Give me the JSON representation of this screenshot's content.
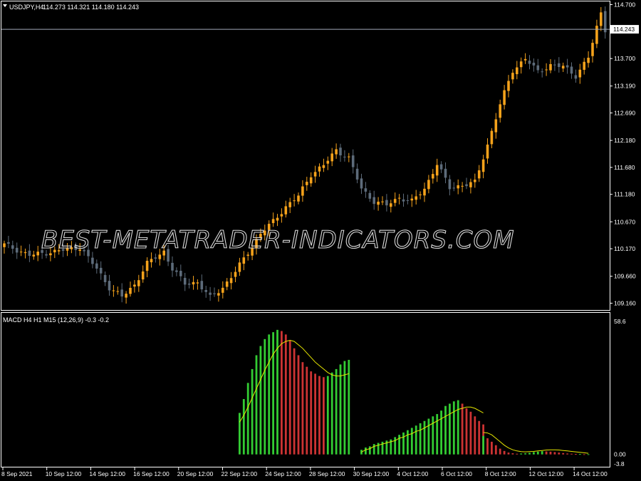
{
  "symbol_header": {
    "symbol": "USDJPY,H4",
    "ohlc": "114.273 114.321 114.180 114.243"
  },
  "current_price": "114.243",
  "watermark": "BEST-METATRADER-INDICATORS.COM",
  "indicator_header": "MACD H4 H1 M15 (12,26,9) -0.3 -0.2",
  "colors": {
    "background": "#000000",
    "frame": "#ffffff",
    "bull_candle": "#f5a21b",
    "bear_candle": "#5d6b7a",
    "hist_up": "#33cc33",
    "hist_down": "#cc3333",
    "signal": "#e6e600",
    "price_line": "#a0a8b8"
  },
  "chart_data": [
    {
      "type": "candlestick",
      "title": "USDJPY,H4",
      "price_axis": [
        "114.700",
        "114.243",
        "113.700",
        "113.190",
        "112.690",
        "112.180",
        "111.680",
        "111.180",
        "110.670",
        "110.170",
        "109.660",
        "109.160"
      ],
      "ylim": [
        109.1,
        114.72
      ],
      "time_axis": [
        "8 Sep 2021",
        "10 Sep 12:00",
        "14 Sep 12:00",
        "16 Sep 12:00",
        "20 Sep 12:00",
        "22 Sep 12:00",
        "24 Sep 12:00",
        "28 Sep 12:00",
        "30 Sep 12:00",
        "4 Oct 12:00",
        "6 Oct 12:00",
        "8 Oct 12:00",
        "12 Oct 12:00",
        "14 Oct 12:00"
      ],
      "close_anchors": [
        [
          0,
          110.25
        ],
        [
          6,
          110.05
        ],
        [
          12,
          110.12
        ],
        [
          18,
          110.2
        ],
        [
          22,
          109.8
        ],
        [
          25,
          109.45
        ],
        [
          28,
          109.28
        ],
        [
          31,
          109.5
        ],
        [
          34,
          109.9
        ],
        [
          38,
          110.12
        ],
        [
          40,
          109.8
        ],
        [
          43,
          109.52
        ],
        [
          46,
          109.55
        ],
        [
          49,
          109.26
        ],
        [
          52,
          109.45
        ],
        [
          55,
          109.75
        ],
        [
          58,
          110.1
        ],
        [
          61,
          110.45
        ],
        [
          64,
          110.68
        ],
        [
          67,
          110.95
        ],
        [
          70,
          111.15
        ],
        [
          73,
          111.55
        ],
        [
          76,
          111.72
        ],
        [
          79,
          112.0
        ],
        [
          82,
          111.85
        ],
        [
          85,
          111.28
        ],
        [
          88,
          111.05
        ],
        [
          91,
          110.98
        ],
        [
          94,
          111.12
        ],
        [
          97,
          111.05
        ],
        [
          100,
          111.28
        ],
        [
          103,
          111.75
        ],
        [
          106,
          111.3
        ],
        [
          109,
          111.35
        ],
        [
          112,
          111.4
        ],
        [
          115,
          112.1
        ],
        [
          118,
          112.85
        ],
        [
          121,
          113.48
        ],
        [
          124,
          113.7
        ],
        [
          127,
          113.45
        ],
        [
          130,
          113.58
        ],
        [
          133,
          113.55
        ],
        [
          136,
          113.38
        ],
        [
          139,
          113.72
        ],
        [
          142,
          114.55
        ],
        [
          143,
          114.24
        ]
      ]
    },
    {
      "type": "bar",
      "title": "MACD H4 H1 M15 (12,26,9) -0.3 -0.2",
      "value_axis": [
        "58.6",
        "0.00",
        "-3.8"
      ],
      "ylim": [
        -3.8,
        58.6
      ],
      "segments": [
        {
          "start": 56,
          "values": [
            18,
            24,
            31,
            37,
            43,
            47,
            50,
            52,
            53,
            54,
            53.5,
            52,
            49.5,
            46,
            43,
            40,
            38,
            36,
            35,
            34,
            33.5,
            34,
            35.5,
            37,
            39,
            40.5,
            41
          ],
          "signal": [
            14,
            17,
            20.5,
            24.5,
            28.5,
            32.5,
            36.5,
            40,
            43.5,
            46,
            48,
            49,
            49.5,
            49,
            47.5,
            46,
            44,
            42,
            40,
            38.5,
            37,
            35.5,
            34.5,
            34,
            34,
            34.5,
            35
          ]
        },
        {
          "start": 85,
          "values": [
            2,
            3,
            3.5,
            4.5,
            5,
            5.5,
            6,
            6.5,
            7.5,
            8.5,
            9.5,
            10.5,
            11.5,
            12.5,
            13.5,
            14.5,
            15.5,
            16.5,
            17.5,
            19,
            21,
            22,
            23,
            23.5,
            22,
            20,
            18.5,
            16.5,
            14.5,
            13
          ],
          "signal": [
            1,
            2,
            2.5,
            3.5,
            4,
            4.5,
            5,
            5.5,
            6,
            7,
            7.5,
            8.5,
            9,
            10,
            10.5,
            11.5,
            12.5,
            13.5,
            14.5,
            15.5,
            16.5,
            17.5,
            18.5,
            19.5,
            20,
            20.5,
            20.5,
            20,
            19,
            18
          ]
        },
        {
          "start": 114,
          "values": [
            8,
            7,
            5.5,
            4,
            2.5,
            1.5,
            0.8,
            0.5,
            0.3,
            0.4,
            0.5,
            0.7,
            1,
            1.2,
            1.4,
            1.3,
            1.2,
            1,
            0.8,
            0.6,
            0.4,
            0.3,
            0.2,
            0.2,
            0.1,
            0.1
          ],
          "signal": [
            9.5,
            9.3,
            8.5,
            7,
            5.5,
            4,
            2.8,
            2,
            1.5,
            1.2,
            1.1,
            1.2,
            1.3,
            1.5,
            1.7,
            1.9,
            2,
            2,
            1.9,
            1.7,
            1.5,
            1.3,
            1.1,
            0.9,
            0.7,
            0.5
          ]
        }
      ]
    }
  ]
}
